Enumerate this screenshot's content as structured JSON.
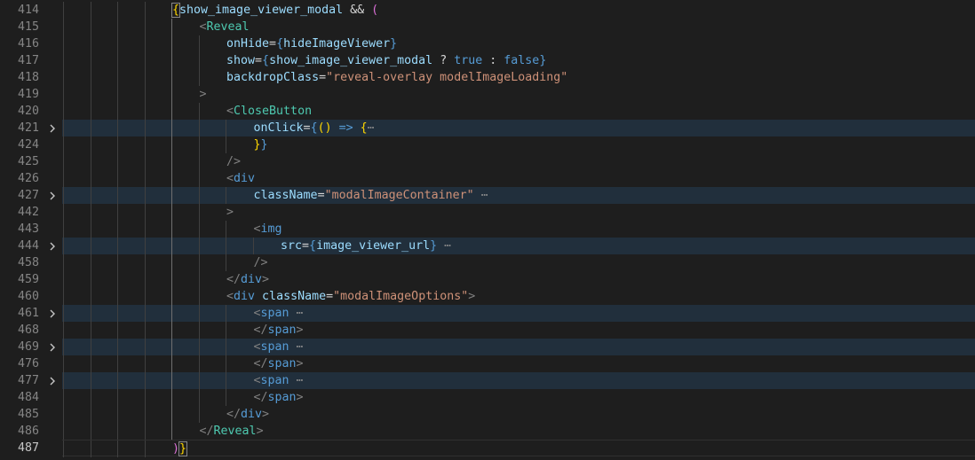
{
  "lines": [
    {
      "num": "414",
      "depth": 4,
      "folded": false,
      "current": false,
      "tokens": [
        {
          "t": "{",
          "c": "t-brace1 t-bm"
        },
        {
          "t": "show_image_viewer_modal",
          "c": "t-var"
        },
        {
          "t": " && ",
          "c": "t-plain"
        },
        {
          "t": "(",
          "c": "t-brace2"
        }
      ]
    },
    {
      "num": "415",
      "depth": 5,
      "folded": false,
      "current": false,
      "tokens": [
        {
          "t": "<",
          "c": "t-punct"
        },
        {
          "t": "Reveal",
          "c": "t-tag"
        }
      ]
    },
    {
      "num": "416",
      "depth": 6,
      "folded": false,
      "current": false,
      "tokens": [
        {
          "t": "onHide",
          "c": "t-attr"
        },
        {
          "t": "=",
          "c": "t-plain"
        },
        {
          "t": "{",
          "c": "t-html"
        },
        {
          "t": "hideImageViewer",
          "c": "t-var"
        },
        {
          "t": "}",
          "c": "t-html"
        }
      ]
    },
    {
      "num": "417",
      "depth": 6,
      "folded": false,
      "current": false,
      "tokens": [
        {
          "t": "show",
          "c": "t-attr"
        },
        {
          "t": "=",
          "c": "t-plain"
        },
        {
          "t": "{",
          "c": "t-html"
        },
        {
          "t": "show_image_viewer_modal",
          "c": "t-var"
        },
        {
          "t": " ? ",
          "c": "t-plain"
        },
        {
          "t": "true",
          "c": "t-kw"
        },
        {
          "t": " : ",
          "c": "t-plain"
        },
        {
          "t": "false",
          "c": "t-kw"
        },
        {
          "t": "}",
          "c": "t-html"
        }
      ]
    },
    {
      "num": "418",
      "depth": 6,
      "folded": false,
      "current": false,
      "tokens": [
        {
          "t": "backdropClass",
          "c": "t-attr"
        },
        {
          "t": "=",
          "c": "t-plain"
        },
        {
          "t": "\"reveal-overlay modelImageLoading\"",
          "c": "t-str"
        }
      ]
    },
    {
      "num": "419",
      "depth": 5,
      "folded": false,
      "current": false,
      "tokens": [
        {
          "t": ">",
          "c": "t-punct"
        }
      ]
    },
    {
      "num": "420",
      "depth": 6,
      "folded": false,
      "current": false,
      "tokens": [
        {
          "t": "<",
          "c": "t-punct"
        },
        {
          "t": "CloseButton",
          "c": "t-tag"
        }
      ]
    },
    {
      "num": "421",
      "depth": 7,
      "folded": true,
      "current": false,
      "tokens": [
        {
          "t": "onClick",
          "c": "t-attr"
        },
        {
          "t": "=",
          "c": "t-plain"
        },
        {
          "t": "{",
          "c": "t-html"
        },
        {
          "t": "() ",
          "c": "t-brace1"
        },
        {
          "t": "=>",
          "c": "t-kw"
        },
        {
          "t": " ",
          "c": "t-plain"
        },
        {
          "t": "{",
          "c": "t-brace1"
        },
        {
          "t": "⋯",
          "c": "t-ellipsis"
        }
      ]
    },
    {
      "num": "424",
      "depth": 7,
      "folded": false,
      "current": false,
      "tokens": [
        {
          "t": "}",
          "c": "t-brace1"
        },
        {
          "t": "}",
          "c": "t-html"
        }
      ]
    },
    {
      "num": "425",
      "depth": 6,
      "folded": false,
      "current": false,
      "tokens": [
        {
          "t": "/>",
          "c": "t-punct"
        }
      ]
    },
    {
      "num": "426",
      "depth": 6,
      "folded": false,
      "current": false,
      "tokens": [
        {
          "t": "<",
          "c": "t-punct"
        },
        {
          "t": "div",
          "c": "t-html"
        }
      ]
    },
    {
      "num": "427",
      "depth": 7,
      "folded": true,
      "current": false,
      "tokens": [
        {
          "t": "className",
          "c": "t-attr"
        },
        {
          "t": "=",
          "c": "t-plain"
        },
        {
          "t": "\"modalImageContainer\"",
          "c": "t-str"
        },
        {
          "t": " ⋯",
          "c": "t-ellipsis"
        }
      ]
    },
    {
      "num": "442",
      "depth": 6,
      "folded": false,
      "current": false,
      "tokens": [
        {
          "t": ">",
          "c": "t-punct"
        }
      ]
    },
    {
      "num": "443",
      "depth": 7,
      "folded": false,
      "current": false,
      "tokens": [
        {
          "t": "<",
          "c": "t-punct"
        },
        {
          "t": "img",
          "c": "t-html"
        }
      ]
    },
    {
      "num": "444",
      "depth": 8,
      "folded": true,
      "current": false,
      "tokens": [
        {
          "t": "src",
          "c": "t-attr"
        },
        {
          "t": "=",
          "c": "t-plain"
        },
        {
          "t": "{",
          "c": "t-html"
        },
        {
          "t": "image_viewer_url",
          "c": "t-var"
        },
        {
          "t": "}",
          "c": "t-html"
        },
        {
          "t": " ⋯",
          "c": "t-ellipsis"
        }
      ]
    },
    {
      "num": "458",
      "depth": 7,
      "folded": false,
      "current": false,
      "tokens": [
        {
          "t": "/>",
          "c": "t-punct"
        }
      ]
    },
    {
      "num": "459",
      "depth": 6,
      "folded": false,
      "current": false,
      "tokens": [
        {
          "t": "</",
          "c": "t-punct"
        },
        {
          "t": "div",
          "c": "t-html"
        },
        {
          "t": ">",
          "c": "t-punct"
        }
      ]
    },
    {
      "num": "460",
      "depth": 6,
      "folded": false,
      "current": false,
      "tokens": [
        {
          "t": "<",
          "c": "t-punct"
        },
        {
          "t": "div",
          "c": "t-html"
        },
        {
          "t": " className",
          "c": "t-attr"
        },
        {
          "t": "=",
          "c": "t-plain"
        },
        {
          "t": "\"modalImageOptions\"",
          "c": "t-str"
        },
        {
          "t": ">",
          "c": "t-punct"
        }
      ]
    },
    {
      "num": "461",
      "depth": 7,
      "folded": true,
      "current": false,
      "tokens": [
        {
          "t": "<",
          "c": "t-punct"
        },
        {
          "t": "span",
          "c": "t-html"
        },
        {
          "t": " ⋯",
          "c": "t-ellipsis"
        }
      ]
    },
    {
      "num": "468",
      "depth": 7,
      "folded": false,
      "current": false,
      "tokens": [
        {
          "t": "</",
          "c": "t-punct"
        },
        {
          "t": "span",
          "c": "t-html"
        },
        {
          "t": ">",
          "c": "t-punct"
        }
      ]
    },
    {
      "num": "469",
      "depth": 7,
      "folded": true,
      "current": false,
      "tokens": [
        {
          "t": "<",
          "c": "t-punct"
        },
        {
          "t": "span",
          "c": "t-html"
        },
        {
          "t": " ⋯",
          "c": "t-ellipsis"
        }
      ]
    },
    {
      "num": "476",
      "depth": 7,
      "folded": false,
      "current": false,
      "tokens": [
        {
          "t": "</",
          "c": "t-punct"
        },
        {
          "t": "span",
          "c": "t-html"
        },
        {
          "t": ">",
          "c": "t-punct"
        }
      ]
    },
    {
      "num": "477",
      "depth": 7,
      "folded": true,
      "current": false,
      "tokens": [
        {
          "t": "<",
          "c": "t-punct"
        },
        {
          "t": "span",
          "c": "t-html"
        },
        {
          "t": " ⋯",
          "c": "t-ellipsis"
        }
      ]
    },
    {
      "num": "484",
      "depth": 7,
      "folded": false,
      "current": false,
      "tokens": [
        {
          "t": "</",
          "c": "t-punct"
        },
        {
          "t": "span",
          "c": "t-html"
        },
        {
          "t": ">",
          "c": "t-punct"
        }
      ]
    },
    {
      "num": "485",
      "depth": 6,
      "folded": false,
      "current": false,
      "tokens": [
        {
          "t": "</",
          "c": "t-punct"
        },
        {
          "t": "div",
          "c": "t-html"
        },
        {
          "t": ">",
          "c": "t-punct"
        }
      ]
    },
    {
      "num": "486",
      "depth": 5,
      "folded": false,
      "current": false,
      "tokens": [
        {
          "t": "</",
          "c": "t-punct"
        },
        {
          "t": "Reveal",
          "c": "t-tag"
        },
        {
          "t": ">",
          "c": "t-punct"
        }
      ]
    },
    {
      "num": "487",
      "depth": 4,
      "folded": false,
      "current": true,
      "tokens": [
        {
          "t": ")",
          "c": "t-brace2"
        },
        {
          "t": "}",
          "c": "t-brace1 t-bm"
        }
      ]
    }
  ]
}
